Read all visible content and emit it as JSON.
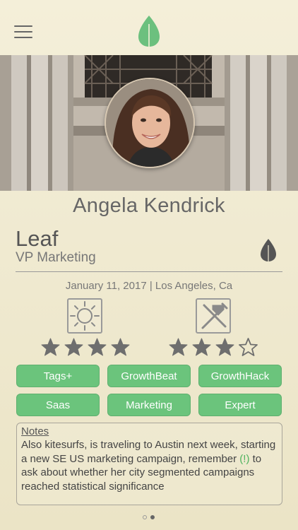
{
  "profile": {
    "name": "Angela Kendrick",
    "company": "Leaf",
    "title": "VP Marketing",
    "date_location": "January 11, 2017 | Los Angeles, Ca"
  },
  "ratings": [
    {
      "icon": "sun-icon",
      "stars": 4,
      "max": 4
    },
    {
      "icon": "tools-icon",
      "stars": 3,
      "max": 4
    }
  ],
  "tags": [
    {
      "label": "Tags+"
    },
    {
      "label": "GrowthBeat"
    },
    {
      "label": "GrowthHack"
    },
    {
      "label": "Saas"
    },
    {
      "label": "Marketing"
    },
    {
      "label": "Expert"
    }
  ],
  "notes": {
    "title": "Notes",
    "body_pre": "Also kitesurfs, is traveling to Austin next week, starting a new SE US marketing campaign, remember ",
    "alert": "(!)",
    "body_post": " to ask about whether her city segmented campaigns reached statistical significance"
  },
  "pager": {
    "pages": 2,
    "active": 2
  },
  "colors": {
    "accent": "#6bc47c",
    "leaf": "#6cc07e",
    "background": "#f0ead3"
  }
}
